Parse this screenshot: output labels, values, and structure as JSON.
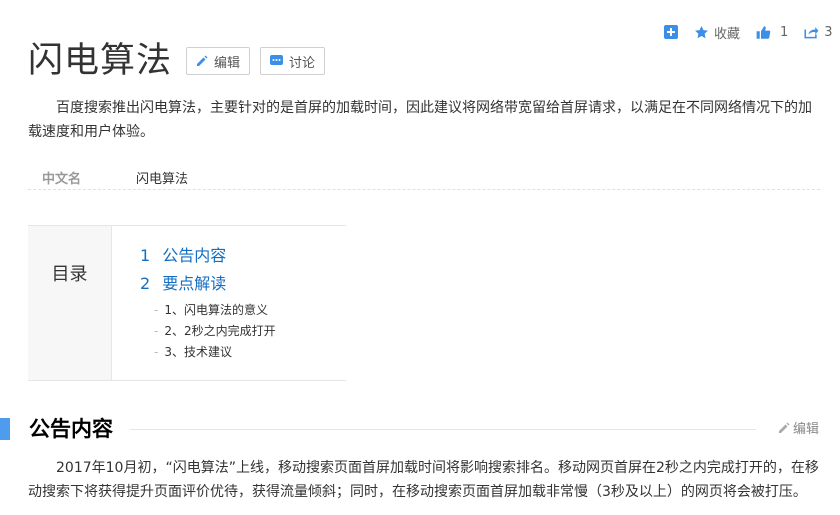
{
  "toolbar": {
    "favorite_label": "收藏",
    "like_count": "1",
    "share_count": "3"
  },
  "title": "闪电算法",
  "buttons": {
    "edit": "编辑",
    "discuss": "讨论"
  },
  "summary": "百度搜索推出闪电算法，主要针对的是首屏的加载时间，因此建议将网络带宽留给首屏请求，以满足在不同网络情况下的加载速度和用户体验。",
  "info": {
    "key": "中文名",
    "value": "闪电算法"
  },
  "catalog": {
    "label": "目录",
    "items": [
      {
        "num": "1",
        "text": "公告内容"
      },
      {
        "num": "2",
        "text": "要点解读"
      }
    ],
    "subitems": [
      "1、闪电算法的意义",
      "2、2秒之内完成打开",
      "3、技术建议"
    ]
  },
  "section": {
    "title": "公告内容",
    "edit_label": "编辑",
    "paragraph": "2017年10月初，“闪电算法”上线，移动搜索页面首屏加载时间将影响搜索排名。移动网页首屏在2秒之内完成打开的，在移动搜索下将获得提升页面评价优待，获得流量倾斜；同时，在移动搜索页面首屏加载非常慢（3秒及以上）的网页将会被打压。"
  },
  "colors": {
    "accent": "#4f9cee",
    "link": "#136ec2",
    "icon_blue": "#3b8fe6"
  }
}
